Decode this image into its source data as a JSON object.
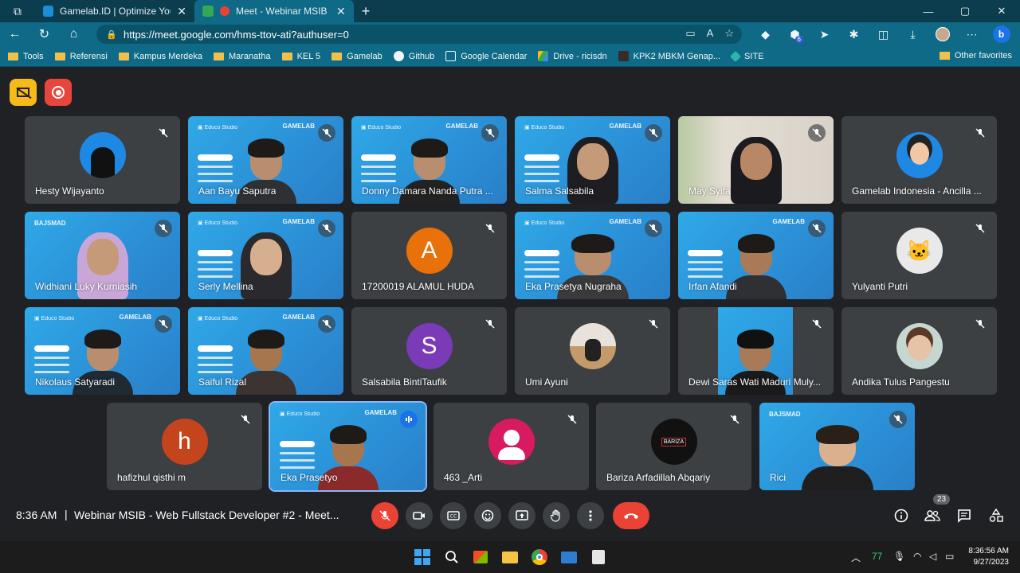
{
  "browser": {
    "tabs": [
      {
        "title": "Gamelab.ID | Optimize Your Digit",
        "active": false
      },
      {
        "title": "Meet - Webinar MSIB - Web",
        "active": true
      }
    ],
    "new_tab": "+",
    "url": "https://meet.google.com/hms-ttov-ati?authuser=0",
    "extension_badge": "6",
    "bing_label": "b",
    "bookmarks": [
      "Tools",
      "Referensi",
      "Kampus Merdeka",
      "Maranatha",
      "KEL 5",
      "Gamelab",
      "Github",
      "Google Calendar",
      "Drive - ricisdn",
      "KPK2 MBKM Genap...",
      "SITE"
    ],
    "other_favorites": "Other favorites"
  },
  "meet": {
    "participants": [
      {
        "name": "Hesty Wijayanto",
        "type": "avatar"
      },
      {
        "name": "Aan Bayu Saputra",
        "type": "video"
      },
      {
        "name": "Donny Damara Nanda Putra ...",
        "type": "video"
      },
      {
        "name": "Salma Salsabila",
        "type": "video"
      },
      {
        "name": "May Syifa",
        "type": "photo"
      },
      {
        "name": "Gamelab Indonesia - Ancilla ...",
        "type": "avatar"
      },
      {
        "name": "Widhiani Luky Kurniasih",
        "type": "video"
      },
      {
        "name": "Serly Mellina",
        "type": "video"
      },
      {
        "name": "17200019 ALAMUL HUDA",
        "type": "letter",
        "letter": "A"
      },
      {
        "name": "Eka Prasetya Nugraha",
        "type": "video"
      },
      {
        "name": "Irfan Afandi",
        "type": "video"
      },
      {
        "name": "Yulyanti Putri",
        "type": "avatar"
      },
      {
        "name": "Nikolaus Satyaradi",
        "type": "video"
      },
      {
        "name": "Saiful Rizal",
        "type": "video"
      },
      {
        "name": "Salsabila BintiTaufik",
        "type": "letter",
        "letter": "S"
      },
      {
        "name": "Umi Ayuni",
        "type": "avatar"
      },
      {
        "name": "Dewi Saras Wati Maduri Muly...",
        "type": "video"
      },
      {
        "name": "Andika Tulus Pangestu",
        "type": "avatar"
      },
      {
        "name": "hafizhul qisthi m",
        "type": "letter",
        "letter": "h"
      },
      {
        "name": "Eka Prasetyo",
        "type": "video",
        "speaking": true
      },
      {
        "name": "463 _Arti",
        "type": "avatar"
      },
      {
        "name": "Bariza Arfadillah Abqariy",
        "type": "avatar",
        "logo_text": "BARIZA"
      },
      {
        "name": "Rici",
        "type": "video"
      }
    ],
    "time": "8:36 AM",
    "separator": "|",
    "meeting_title": "Webinar MSIB - Web Fullstack Developer #2 - Meet...",
    "participant_count": "23"
  },
  "taskbar": {
    "tray_number": "77",
    "clock_time": "8:36:56 AM",
    "clock_date": "9/27/2023"
  }
}
